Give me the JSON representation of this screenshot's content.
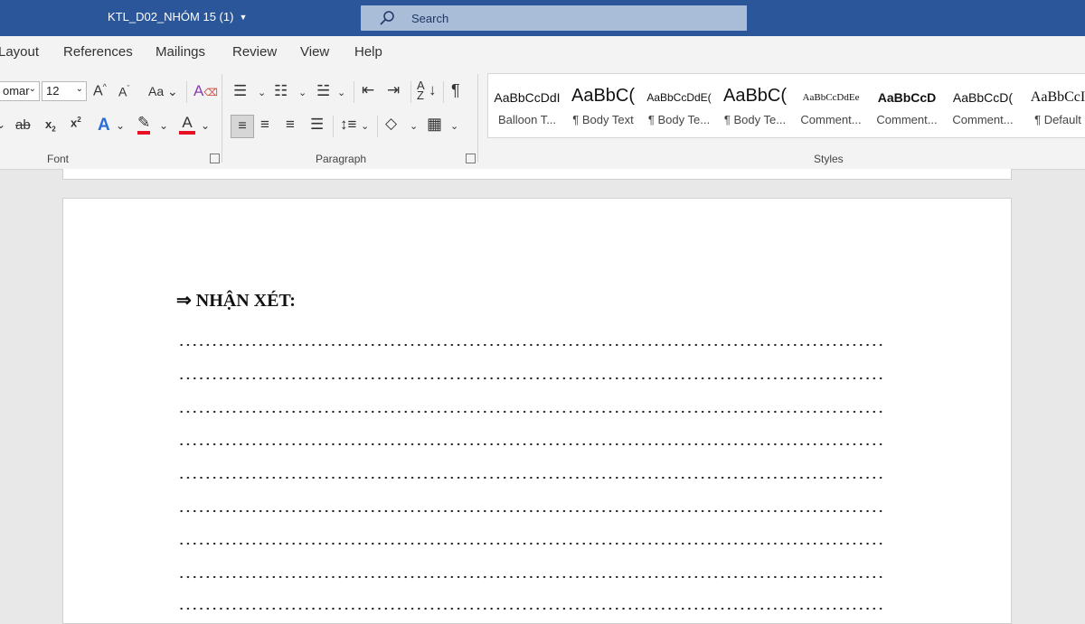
{
  "titlebar": {
    "doc_title": "KTL_D02_NHÓM 15 (1)",
    "search_placeholder": "Search",
    "color": "#2b579a"
  },
  "menu": {
    "tabs": [
      "Layout",
      "References",
      "Mailings",
      "Review",
      "View",
      "Help"
    ]
  },
  "ribbon": {
    "font": {
      "label": "Font",
      "font_name": "omar",
      "font_size": "12",
      "case_label": "Aa"
    },
    "paragraph": {
      "label": "Paragraph"
    },
    "styles": {
      "label": "Styles",
      "items": [
        {
          "preview": "AaBbCcDdI",
          "name": "Balloon T..."
        },
        {
          "preview": "AaBbC(",
          "name": "¶ Body Text"
        },
        {
          "preview": "AaBbCcDdE(",
          "name": "¶ Body Te..."
        },
        {
          "preview": "AaBbC(",
          "name": "¶ Body Te..."
        },
        {
          "preview": "AaBbCcDdEe",
          "name": "Comment..."
        },
        {
          "preview": "AaBbCcD",
          "name": "Comment..."
        },
        {
          "preview": "AaBbCcD(",
          "name": "Comment..."
        },
        {
          "preview": "AaBbCcI",
          "name": "¶ Default"
        }
      ]
    },
    "accent_colors": {
      "highlight": "#e81123",
      "font_color": "#e81123",
      "text_effects": "#2b6cd6"
    }
  },
  "document": {
    "heading_arrow": "⇒",
    "heading": "NHẬN XÉT:",
    "dotted_line_count": 9
  }
}
